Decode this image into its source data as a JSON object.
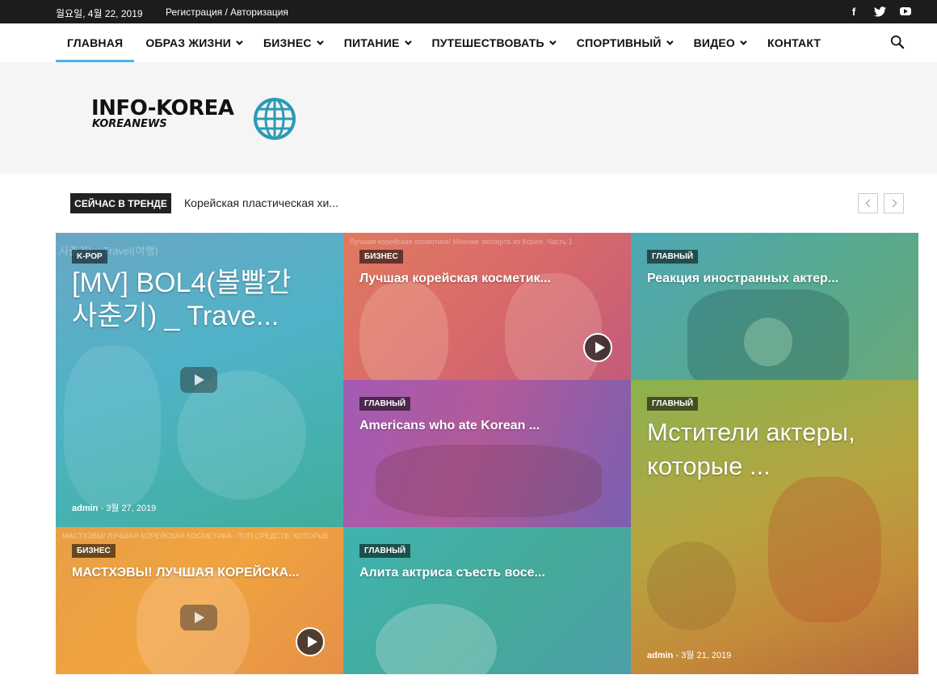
{
  "topbar": {
    "date": "월요일, 4월 22, 2019",
    "auth_link": "Регистрация / Авторизация",
    "social": [
      "facebook-icon",
      "twitter-icon",
      "youtube-icon"
    ]
  },
  "nav": {
    "items": [
      {
        "label": "ГЛАВНАЯ"
      },
      {
        "label": "ОБРАЗ ЖИЗНИ"
      },
      {
        "label": "БИЗНЕС"
      },
      {
        "label": "ПИТАНИЕ"
      },
      {
        "label": "ПУТЕШЕСТВОВАТЬ"
      },
      {
        "label": "СПОРТИВНЫЙ"
      },
      {
        "label": "ВИДЕО"
      },
      {
        "label": "КОНТАКТ"
      }
    ]
  },
  "logo": {
    "line1": "INFO-KOREA",
    "line2": "KOREANEWS"
  },
  "trending": {
    "label": "СЕЙЧАС В ТРЕНДЕ",
    "headline": "Корейская пластическая хи..."
  },
  "tiles": [
    {
      "category": "K-POP",
      "title": "[MV] BOL4(볼빨간 사춘기) _ Trave...",
      "author": "admin",
      "date": "3월 27, 2019",
      "overlay_text": "사춘기) _ Travel(여행)"
    },
    {
      "category": "БИЗНЕС",
      "title": "Лучшая корейская косметик...",
      "overlay_text": "Лучшая корейская косметика! Мнение эксперта из Кореи. Часть 1"
    },
    {
      "category": "ГЛАВНЫЙ",
      "title": "Реакция иностранных актер..."
    },
    {
      "category": "ГЛАВНЫЙ",
      "title": "Americans who ate Korean ..."
    },
    {
      "category": "ГЛАВНЫЙ",
      "title": "Мстители актеры, которые ...",
      "author": "admin",
      "date": "3월 21, 2019"
    },
    {
      "category": "БИЗНЕС",
      "title": "МАСТХЭВЫ! ЛУЧШАЯ КОРЕЙСКА...",
      "overlay_text": "МАСТХЭВЫ! ЛУЧШАЯ КОРЕЙСКАЯ КОСМЕТИКА - ТОП СРЕДСТВ, КОТОРЫЕ"
    },
    {
      "category": "ГЛАВНЫЙ",
      "title": "Алита актриса съесть восе..."
    }
  ],
  "colors": {
    "accent": "#4db2ec",
    "topbar": "#1c1c1c",
    "header_band": "#f5f5f5"
  }
}
